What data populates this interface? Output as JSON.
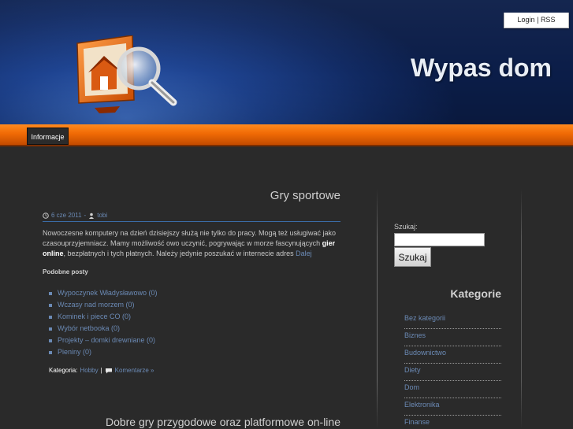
{
  "header": {
    "title": "Wypas dom",
    "toplinks": {
      "login": "Login",
      "separator": "|",
      "rss": "RSS"
    },
    "logo_icon": "house-monitor-magnifier-icon"
  },
  "nav": {
    "items": [
      {
        "label": "Informacje"
      }
    ]
  },
  "post1": {
    "title": "Gry sportowe",
    "date": "6 cze 2011",
    "meta_separator": "-",
    "author": "tobi",
    "text_before": "Nowoczesne komputery na dzień dzisiejszy służą nie tylko do pracy. Mogą też usługiwać jako czasouprzyjemniacz. Mamy możliwość owo uczynić, pogrywając w morze fascynujących ",
    "text_bold": "gier online",
    "text_after": ", bezpłatnych i tych płatnych. Należy jedynie poszukać w internecie adres ",
    "more_link": "Dalej",
    "related_heading": "Podobne posty",
    "related": [
      "Wypoczynek Władysławowo (0)",
      "Wczasy nad morzem (0)",
      "Kominek i piece CO (0)",
      "Wybór netbooka (0)",
      "Projekty – domki drewniane (0)",
      "Pieniny (0)"
    ],
    "category_label": "Kategoria:",
    "category_value": "Hobby",
    "category_separator": "|",
    "comments_label": "Komentarze »"
  },
  "post2": {
    "title": "Dobre gry przygodowe oraz platformowe on-line"
  },
  "sidebar": {
    "search_label": "Szukaj:",
    "search_value": "",
    "search_button": "Szukaj",
    "categories_title": "Kategorie",
    "categories": [
      "Bez kategorii",
      "Biznes",
      "Budownictwo",
      "Diety",
      "Dom",
      "Elektronika",
      "Finanse"
    ]
  },
  "colors": {
    "header_blue": "#1e4390",
    "nav_orange": "#f06a05",
    "link_blue": "#6b8ab5",
    "background": "#2a2a2a"
  }
}
